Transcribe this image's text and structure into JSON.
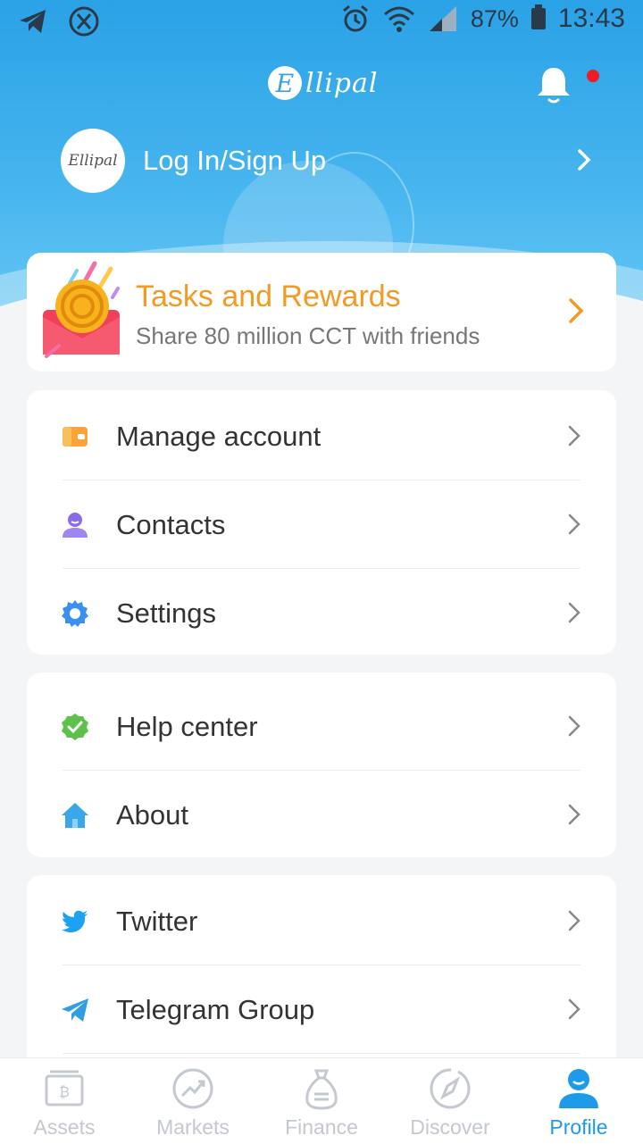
{
  "status_bar": {
    "battery": "87%",
    "time": "13:43"
  },
  "header": {
    "logo_text": "llipal",
    "login_label": "Log In/Sign Up",
    "avatar_text": "Ellipal"
  },
  "tasks_card": {
    "title": "Tasks and Rewards",
    "subtitle": "Share 80 million CCT with friends"
  },
  "menu_group_1": [
    {
      "label": "Manage account",
      "icon": "wallet-icon"
    },
    {
      "label": "Contacts",
      "icon": "contacts-icon"
    },
    {
      "label": "Settings",
      "icon": "gear-icon"
    }
  ],
  "menu_group_2": [
    {
      "label": "Help center",
      "icon": "verified-icon"
    },
    {
      "label": "About",
      "icon": "home-icon"
    }
  ],
  "menu_group_3": [
    {
      "label": "Twitter",
      "icon": "twitter-icon"
    },
    {
      "label": "Telegram Group",
      "icon": "telegram-icon"
    }
  ],
  "bottom_nav": [
    {
      "label": "Assets",
      "active": false
    },
    {
      "label": "Markets",
      "active": false
    },
    {
      "label": "Finance",
      "active": false
    },
    {
      "label": "Discover",
      "active": false
    },
    {
      "label": "Profile",
      "active": true
    }
  ],
  "colors": {
    "header_blue": "#2aa2e6",
    "accent_orange": "#f39a22",
    "active_nav": "#1e9be8",
    "notification_dot": "#ee1c25"
  }
}
